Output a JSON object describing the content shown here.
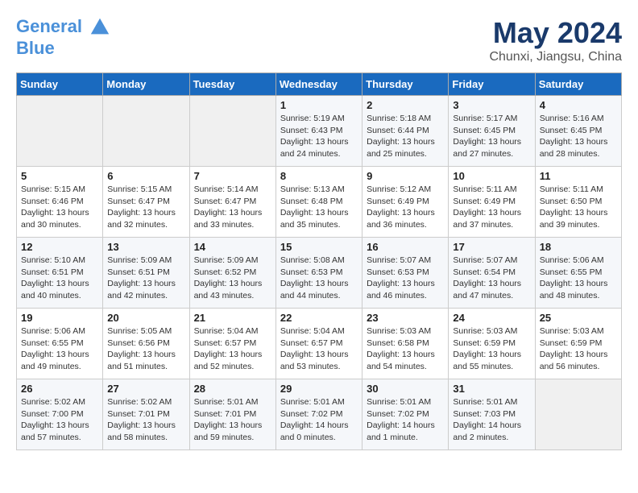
{
  "header": {
    "logo_line1": "General",
    "logo_line2": "Blue",
    "month": "May 2024",
    "location": "Chunxi, Jiangsu, China"
  },
  "weekdays": [
    "Sunday",
    "Monday",
    "Tuesday",
    "Wednesday",
    "Thursday",
    "Friday",
    "Saturday"
  ],
  "weeks": [
    [
      {
        "day": "",
        "details": ""
      },
      {
        "day": "",
        "details": ""
      },
      {
        "day": "",
        "details": ""
      },
      {
        "day": "1",
        "details": "Sunrise: 5:19 AM\nSunset: 6:43 PM\nDaylight: 13 hours\nand 24 minutes."
      },
      {
        "day": "2",
        "details": "Sunrise: 5:18 AM\nSunset: 6:44 PM\nDaylight: 13 hours\nand 25 minutes."
      },
      {
        "day": "3",
        "details": "Sunrise: 5:17 AM\nSunset: 6:45 PM\nDaylight: 13 hours\nand 27 minutes."
      },
      {
        "day": "4",
        "details": "Sunrise: 5:16 AM\nSunset: 6:45 PM\nDaylight: 13 hours\nand 28 minutes."
      }
    ],
    [
      {
        "day": "5",
        "details": "Sunrise: 5:15 AM\nSunset: 6:46 PM\nDaylight: 13 hours\nand 30 minutes."
      },
      {
        "day": "6",
        "details": "Sunrise: 5:15 AM\nSunset: 6:47 PM\nDaylight: 13 hours\nand 32 minutes."
      },
      {
        "day": "7",
        "details": "Sunrise: 5:14 AM\nSunset: 6:47 PM\nDaylight: 13 hours\nand 33 minutes."
      },
      {
        "day": "8",
        "details": "Sunrise: 5:13 AM\nSunset: 6:48 PM\nDaylight: 13 hours\nand 35 minutes."
      },
      {
        "day": "9",
        "details": "Sunrise: 5:12 AM\nSunset: 6:49 PM\nDaylight: 13 hours\nand 36 minutes."
      },
      {
        "day": "10",
        "details": "Sunrise: 5:11 AM\nSunset: 6:49 PM\nDaylight: 13 hours\nand 37 minutes."
      },
      {
        "day": "11",
        "details": "Sunrise: 5:11 AM\nSunset: 6:50 PM\nDaylight: 13 hours\nand 39 minutes."
      }
    ],
    [
      {
        "day": "12",
        "details": "Sunrise: 5:10 AM\nSunset: 6:51 PM\nDaylight: 13 hours\nand 40 minutes."
      },
      {
        "day": "13",
        "details": "Sunrise: 5:09 AM\nSunset: 6:51 PM\nDaylight: 13 hours\nand 42 minutes."
      },
      {
        "day": "14",
        "details": "Sunrise: 5:09 AM\nSunset: 6:52 PM\nDaylight: 13 hours\nand 43 minutes."
      },
      {
        "day": "15",
        "details": "Sunrise: 5:08 AM\nSunset: 6:53 PM\nDaylight: 13 hours\nand 44 minutes."
      },
      {
        "day": "16",
        "details": "Sunrise: 5:07 AM\nSunset: 6:53 PM\nDaylight: 13 hours\nand 46 minutes."
      },
      {
        "day": "17",
        "details": "Sunrise: 5:07 AM\nSunset: 6:54 PM\nDaylight: 13 hours\nand 47 minutes."
      },
      {
        "day": "18",
        "details": "Sunrise: 5:06 AM\nSunset: 6:55 PM\nDaylight: 13 hours\nand 48 minutes."
      }
    ],
    [
      {
        "day": "19",
        "details": "Sunrise: 5:06 AM\nSunset: 6:55 PM\nDaylight: 13 hours\nand 49 minutes."
      },
      {
        "day": "20",
        "details": "Sunrise: 5:05 AM\nSunset: 6:56 PM\nDaylight: 13 hours\nand 51 minutes."
      },
      {
        "day": "21",
        "details": "Sunrise: 5:04 AM\nSunset: 6:57 PM\nDaylight: 13 hours\nand 52 minutes."
      },
      {
        "day": "22",
        "details": "Sunrise: 5:04 AM\nSunset: 6:57 PM\nDaylight: 13 hours\nand 53 minutes."
      },
      {
        "day": "23",
        "details": "Sunrise: 5:03 AM\nSunset: 6:58 PM\nDaylight: 13 hours\nand 54 minutes."
      },
      {
        "day": "24",
        "details": "Sunrise: 5:03 AM\nSunset: 6:59 PM\nDaylight: 13 hours\nand 55 minutes."
      },
      {
        "day": "25",
        "details": "Sunrise: 5:03 AM\nSunset: 6:59 PM\nDaylight: 13 hours\nand 56 minutes."
      }
    ],
    [
      {
        "day": "26",
        "details": "Sunrise: 5:02 AM\nSunset: 7:00 PM\nDaylight: 13 hours\nand 57 minutes."
      },
      {
        "day": "27",
        "details": "Sunrise: 5:02 AM\nSunset: 7:01 PM\nDaylight: 13 hours\nand 58 minutes."
      },
      {
        "day": "28",
        "details": "Sunrise: 5:01 AM\nSunset: 7:01 PM\nDaylight: 13 hours\nand 59 minutes."
      },
      {
        "day": "29",
        "details": "Sunrise: 5:01 AM\nSunset: 7:02 PM\nDaylight: 14 hours\nand 0 minutes."
      },
      {
        "day": "30",
        "details": "Sunrise: 5:01 AM\nSunset: 7:02 PM\nDaylight: 14 hours\nand 1 minute."
      },
      {
        "day": "31",
        "details": "Sunrise: 5:01 AM\nSunset: 7:03 PM\nDaylight: 14 hours\nand 2 minutes."
      },
      {
        "day": "",
        "details": ""
      }
    ]
  ]
}
